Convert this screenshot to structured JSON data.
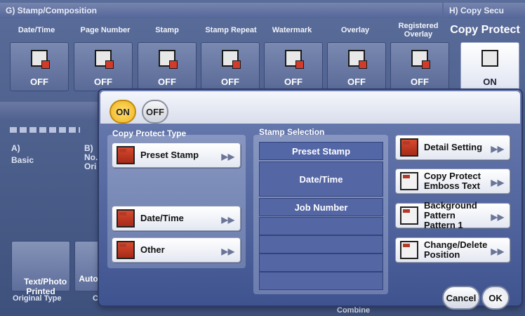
{
  "sections": {
    "stamp_composition": "G) Stamp/Composition",
    "copy_security": "H) Copy Secu"
  },
  "functions": [
    {
      "label": "Date/Time",
      "value": "OFF"
    },
    {
      "label": "Page Number",
      "value": "OFF"
    },
    {
      "label": "Stamp",
      "value": "OFF"
    },
    {
      "label": "Stamp Repeat",
      "value": "OFF"
    },
    {
      "label": "Watermark",
      "value": "OFF"
    },
    {
      "label": "Overlay",
      "value": "OFF"
    },
    {
      "label": "Registered\nOverlay",
      "value": "OFF"
    },
    {
      "label": "Copy Protect",
      "value": "ON"
    }
  ],
  "background": {
    "tab_a": "A)",
    "tab_a_name": "Basic",
    "tab_b": "B)\nNo.\nOri",
    "text_photo_label": "Text/Photo\nPrinted",
    "auto_label": "Auto",
    "original_type_label": "Original Type",
    "c_label": "C",
    "combine_label": "Combine"
  },
  "dialog": {
    "on_label": "ON",
    "off_label": "OFF",
    "copy_protect_type_title": "Copy Protect Type",
    "types": [
      {
        "label": "Preset Stamp",
        "chevron": "▶▶"
      },
      {
        "label": "Date/Time",
        "chevron": "▶▶"
      },
      {
        "label": "Other",
        "chevron": "▶▶"
      }
    ],
    "stamp_selection_title": "Stamp Selection",
    "stamp_rows": [
      "Preset Stamp",
      "Date/Time",
      "Job Number",
      "",
      "",
      "",
      ""
    ],
    "right_buttons": [
      {
        "line1": "Detail Setting",
        "line2": ""
      },
      {
        "line1": "Copy Protect",
        "line2": "Emboss Text"
      },
      {
        "line1": "Background Pattern",
        "line2": "Pattern 1"
      },
      {
        "line1": "Change/Delete",
        "line2": "Position"
      }
    ],
    "cancel_label": "Cancel",
    "ok_label": "OK"
  }
}
